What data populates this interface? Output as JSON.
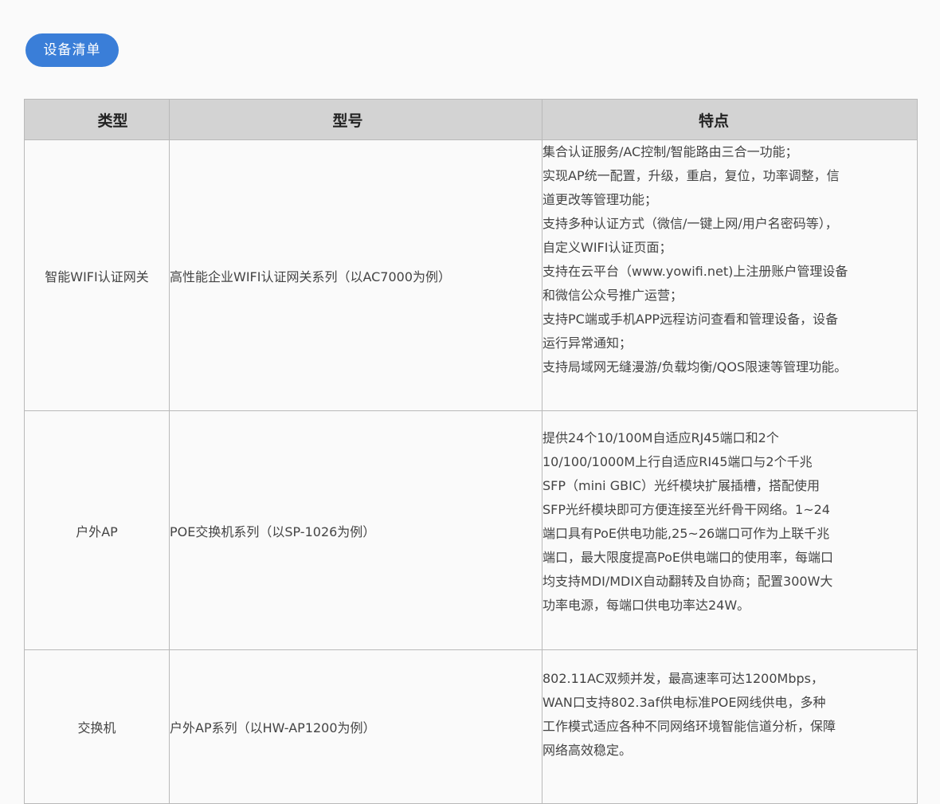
{
  "badge": {
    "label": "设备清单"
  },
  "table": {
    "headers": [
      "类型",
      "型号",
      "特点"
    ],
    "rows": [
      {
        "type": "智能WIFI认证网关",
        "model": "高性能企业WIFI认证网关系列（以AC7000为例）",
        "features": [
          "集合认证服务/AC控制/智能路由三合一功能；",
          "实现AP统一配置，升级，重启，复位，功率调整，信",
          "道更改等管理功能；",
          "支持多种认证方式（微信/一键上网/用户名密码等），",
          "自定义WIFI认证页面；",
          "支持在云平台（www.yowifi.net)上注册账户管理设备",
          "和微信公众号推广运营；",
          "支持PC端或手机APP远程访问查看和管理设备，设备",
          "运行异常通知；",
          "支持局域网无缝漫游/负载均衡/QOS限速等管理功能。"
        ]
      },
      {
        "type": "户外AP",
        "model": "POE交换机系列（以SP-1026为例）",
        "features": [
          "提供24个10/100M自适应RJ45端口和2个",
          "10/100/1000M上行自适应RI45端口与2个千兆",
          "SFP（mini GBIC）光纤模块扩展插槽，搭配使用",
          "SFP光纤模块即可方便连接至光纤骨干网络。1~24",
          "端口具有PoE供电功能,25~26端口可作为上联千兆",
          "端口，最大限度提高PoE供电端口的使用率，每端口",
          "均支持MDI/MDIX自动翻转及自协商；配置300W大",
          "功率电源，每端口供电功率达24W。"
        ]
      },
      {
        "type": "交换机",
        "model": "户外AP系列（以HW-AP1200为例）",
        "features": [
          "802.11AC双频并发，最高速率可达1200Mbps，",
          "WAN口支持802.3af供电标准POE网线供电，多种",
          "工作模式适应各种不同网络环境智能信道分析，保障",
          "网络高效稳定。"
        ]
      }
    ]
  }
}
